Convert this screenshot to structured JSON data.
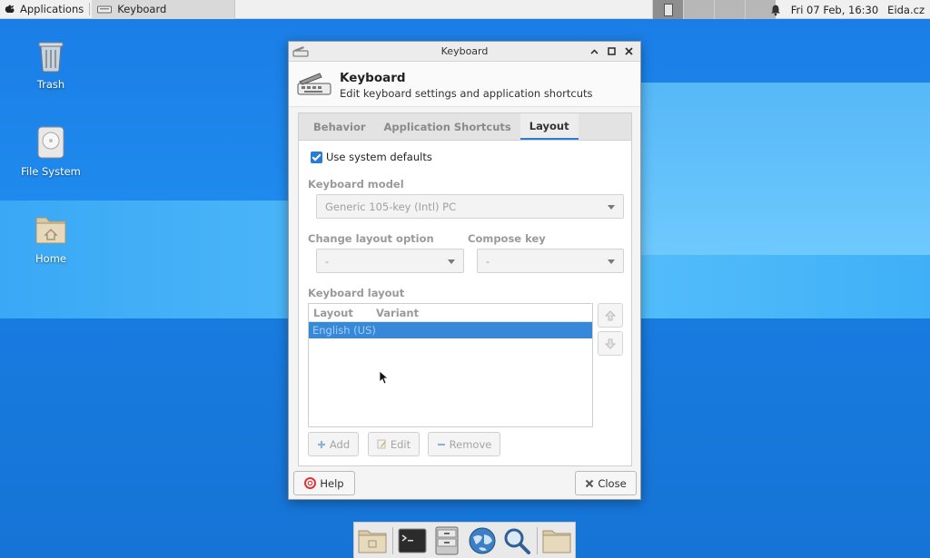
{
  "top_panel": {
    "applications_label": "Applications",
    "task_label": "Keyboard",
    "datetime": "Fri 07 Feb, 16:30",
    "user": "Eida.cz"
  },
  "desktop": {
    "icons": [
      {
        "label": "Trash",
        "icon": "trash-icon"
      },
      {
        "label": "File System",
        "icon": "drive-icon"
      },
      {
        "label": "Home",
        "icon": "home-folder-icon"
      }
    ]
  },
  "dialog": {
    "window_title": "Keyboard",
    "header_title": "Keyboard",
    "header_subtitle": "Edit keyboard settings and application shortcuts",
    "tabs": [
      {
        "label": "Behavior",
        "active": false
      },
      {
        "label": "Application Shortcuts",
        "active": false
      },
      {
        "label": "Layout",
        "active": true
      }
    ],
    "layout_page": {
      "use_system_defaults_label": "Use system defaults",
      "use_system_defaults_checked": true,
      "keyboard_model_label": "Keyboard model",
      "keyboard_model_value": "Generic 105-key (Intl) PC",
      "change_layout_option_label": "Change layout option",
      "change_layout_option_value": "-",
      "compose_key_label": "Compose key",
      "compose_key_value": "-",
      "keyboard_layout_label": "Keyboard layout",
      "columns": [
        "Layout",
        "Variant"
      ],
      "rows": [
        {
          "layout": "English (US)",
          "variant": "",
          "selected": true
        }
      ],
      "add_label": "Add",
      "edit_label": "Edit",
      "remove_label": "Remove"
    },
    "help_label": "Help",
    "close_label": "Close"
  },
  "colors": {
    "accent": "#2c7fd3",
    "desktop_blue": "#1a7fe0",
    "selection": "#3689d8"
  }
}
